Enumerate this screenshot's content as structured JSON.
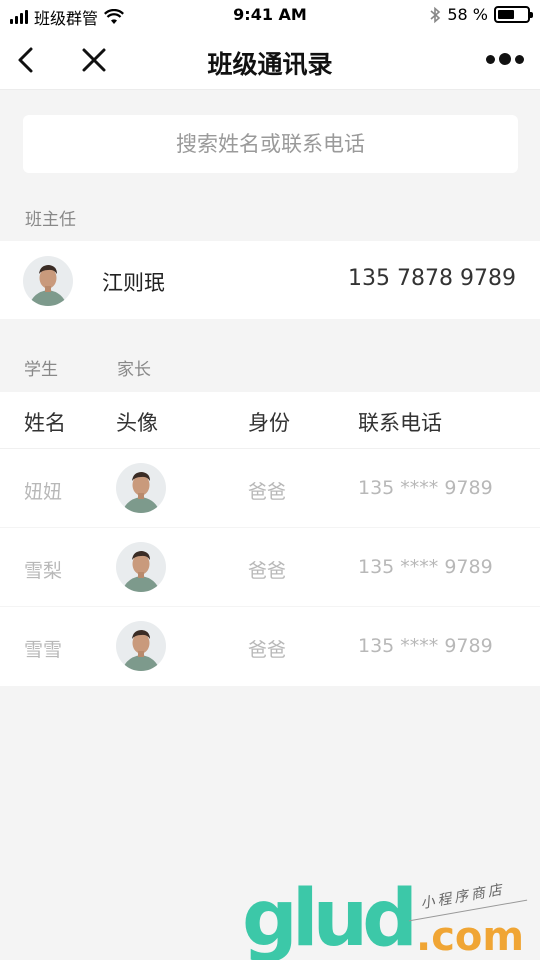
{
  "status_bar": {
    "carrier": "班级群管",
    "time": "9:41 AM",
    "battery": "58 %",
    "battery_level": 0.58
  },
  "nav": {
    "title": "班级通讯录"
  },
  "search": {
    "placeholder": "搜索姓名或联系电话"
  },
  "head_teacher": {
    "section_label": "班主任",
    "name": "江则珉",
    "phone": "135 7878 9789"
  },
  "tabs": {
    "student": "学生",
    "parent": "家长"
  },
  "table": {
    "headers": {
      "name": "姓名",
      "avatar": "头像",
      "role": "身份",
      "phone": "联系电话"
    },
    "rows": [
      {
        "name": "妞妞",
        "role": "爸爸",
        "phone": "135 **** 9789"
      },
      {
        "name": "雪梨",
        "role": "爸爸",
        "phone": "135 **** 9789"
      },
      {
        "name": "雪雪",
        "role": "爸爸",
        "phone": "135 **** 9789"
      }
    ]
  },
  "watermark": {
    "logo": "glud",
    "domain": ".com",
    "slogan": "小程序商店"
  }
}
